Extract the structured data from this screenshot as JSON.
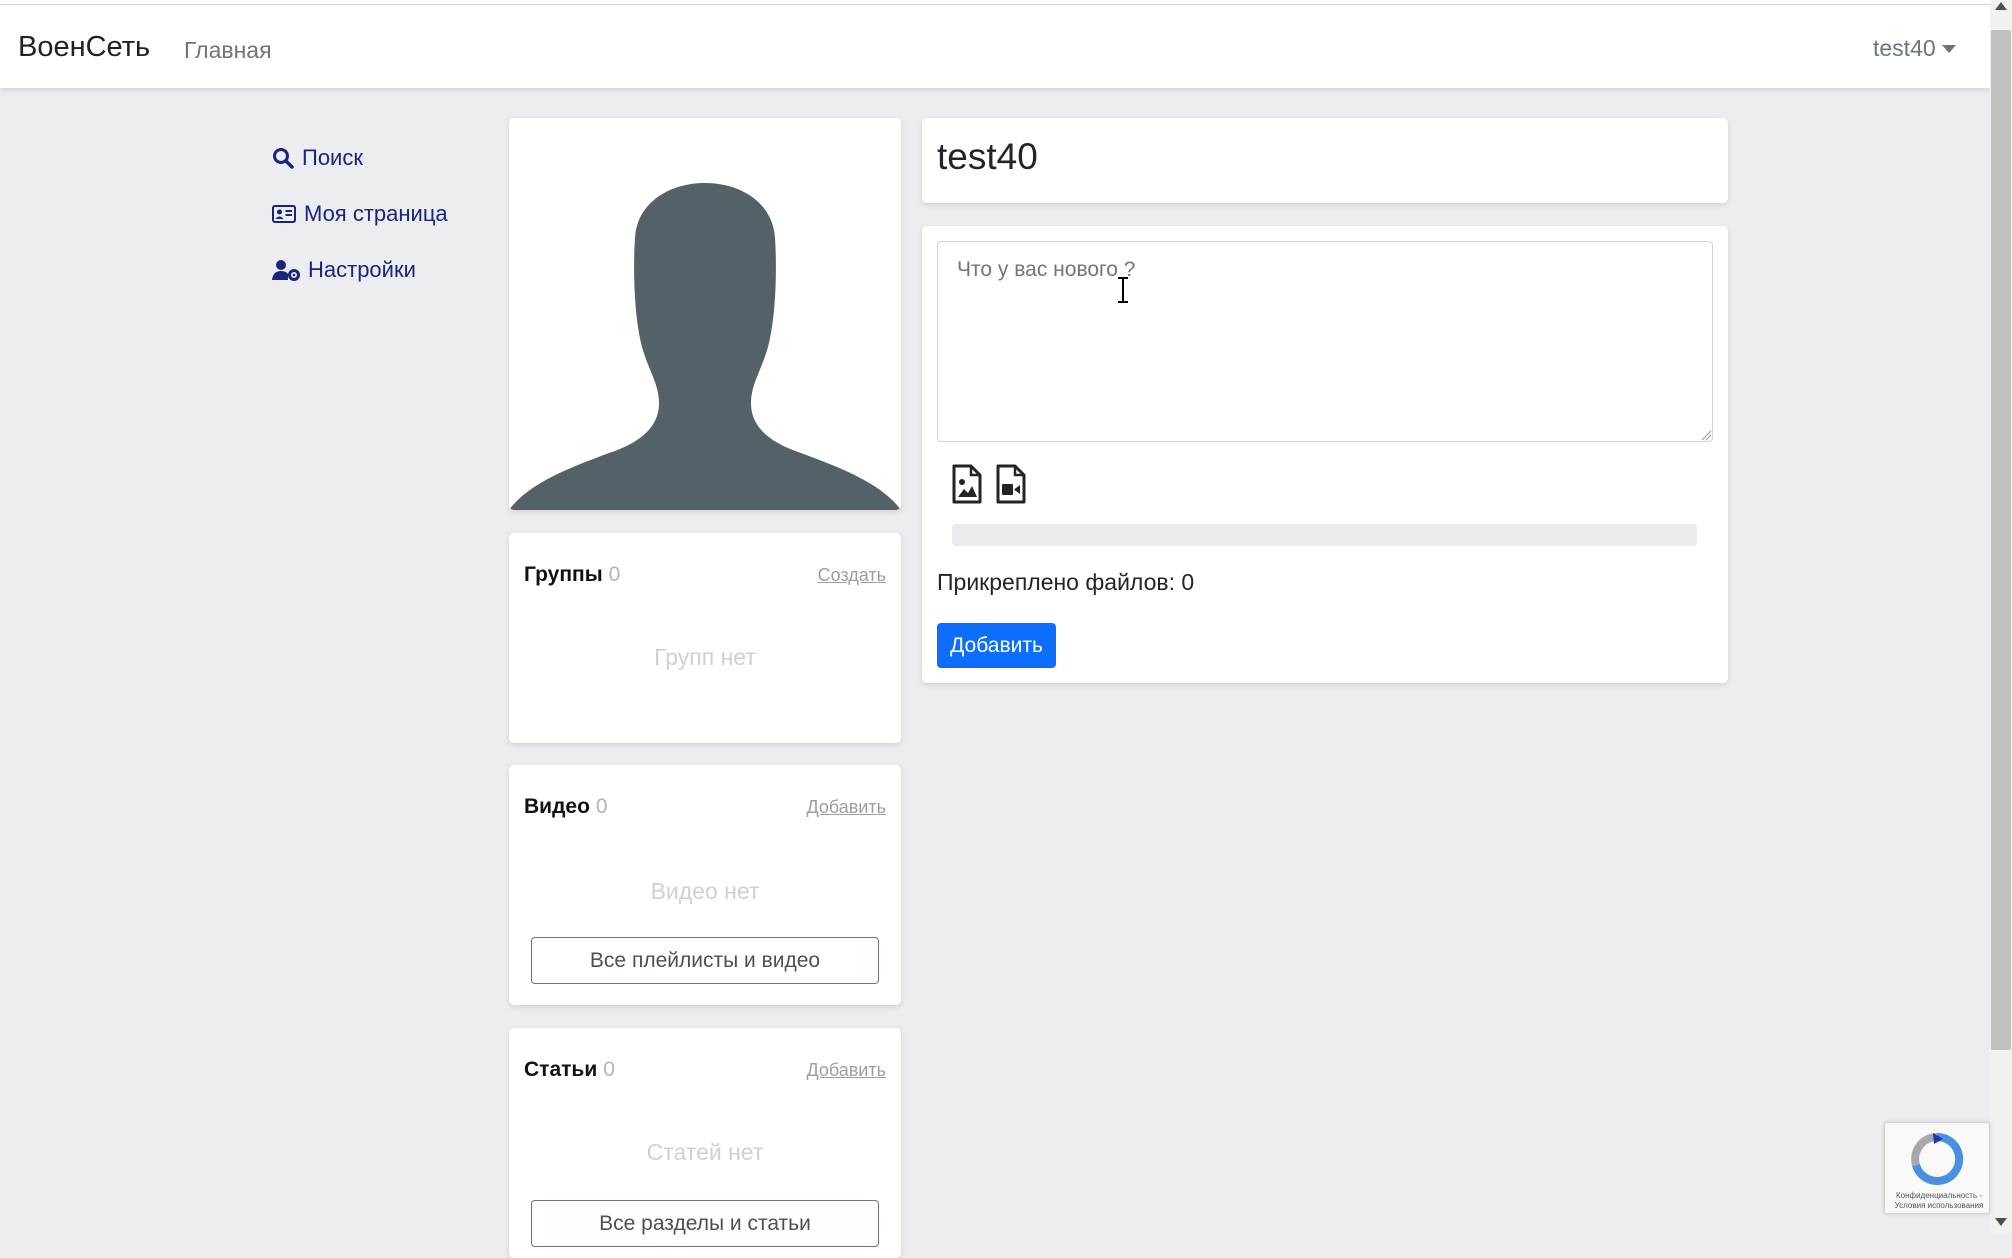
{
  "navbar": {
    "brand": "ВоенСеть",
    "home": "Главная",
    "username": "test40"
  },
  "sidebar": {
    "items": [
      {
        "label": "Поиск",
        "icon": "search-icon"
      },
      {
        "label": "Моя страница",
        "icon": "id-card-icon"
      },
      {
        "label": "Настройки",
        "icon": "user-cog-icon"
      }
    ]
  },
  "groups": {
    "title": "Группы",
    "count": "0",
    "link": "Создать",
    "empty": "Групп нет"
  },
  "videos": {
    "title": "Видео",
    "count": "0",
    "link": "Добавить",
    "empty": "Видео нет",
    "all_button": "Все плейлисты и видео"
  },
  "articles": {
    "title": "Статьи",
    "count": "0",
    "link": "Добавить",
    "empty": "Статей нет",
    "all_button": "Все разделы и статьи"
  },
  "profile": {
    "name": "test40"
  },
  "post": {
    "placeholder": "Что у вас нового ?",
    "upload_progress": 0,
    "attached": "Прикреплено файлов: 0",
    "submit": "Добавить"
  },
  "recaptcha": {
    "text": "Конфиденциальность - Условия использования"
  },
  "colors": {
    "accent": "#0d6efd",
    "sidebar_link": "#1a237e",
    "background": "#ebedf0"
  }
}
